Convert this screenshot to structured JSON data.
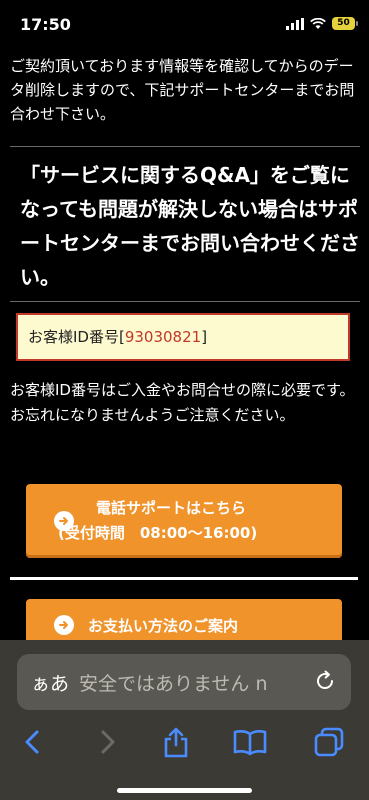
{
  "status": {
    "time": "17:50",
    "battery": "50"
  },
  "page": {
    "intro": "ご契約頂いております情報等を確認してからのデータ削除しますので、下記サポートセンターまでお問合わせ下さい。",
    "qa_notice": "「サービスに関するQ&A」をご覧になっても問題が解決しない場合はサポートセンターまでお問い合わせください。",
    "id_label": "お客様ID番号[",
    "id_number": "93030821",
    "id_suffix": "]",
    "id_note": "お客様ID番号はご入金やお問合せの際に必要です。お忘れになりませんようご注意ください。",
    "phone_button_line1": "電話サポートはこちら",
    "phone_button_line2": "(受付時間　08:00〜16:00)",
    "payment_button": "お支払い方法のご案内"
  },
  "browser": {
    "aa_label": "ぁあ",
    "url_text": "安全ではありません n",
    "icons": [
      "back-icon",
      "forward-icon",
      "share-icon",
      "bookmarks-icon",
      "tabs-icon",
      "reload-icon"
    ]
  },
  "colors": {
    "accent_orange": "#f0932b",
    "id_border": "#c0392b",
    "id_bg": "#fefad0",
    "battery": "#e6d23c"
  }
}
